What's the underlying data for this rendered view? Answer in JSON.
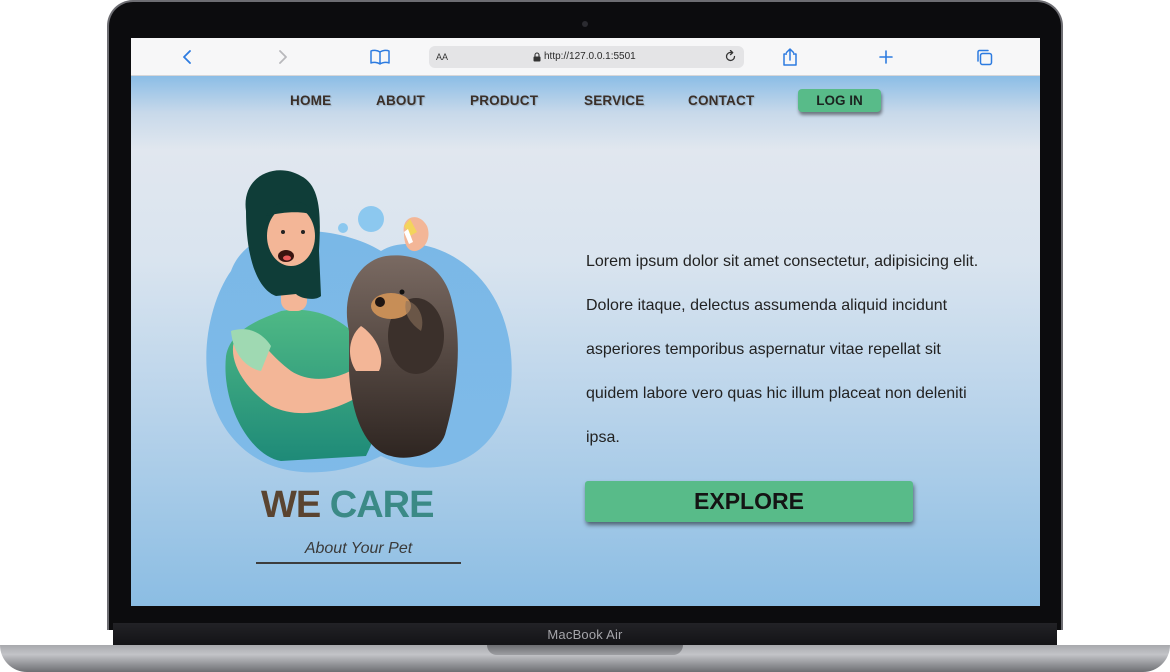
{
  "browser": {
    "reader_label": "AA",
    "url": "http://127.0.0.1:5501",
    "icons": [
      "back-icon",
      "forward-icon",
      "book-icon",
      "lock-icon",
      "reload-icon",
      "share-icon",
      "plus-icon",
      "tabs-icon"
    ]
  },
  "nav": {
    "items": [
      "HOME",
      "ABOUT",
      "PRODUCT",
      "SERVICE",
      "CONTACT"
    ],
    "login_label": "LOG IN"
  },
  "hero": {
    "title_we": "WE",
    "title_care": "CARE",
    "subtitle": "About Your Pet",
    "paragraph": "Lorem ipsum dolor sit amet consectetur, adipisicing elit. Dolore itaque, delectus assumenda aliquid incidunt asperiores temporibus aspernatur vitae repellat sit quidem labore vero quas hic illum placeat non deleniti ipsa.",
    "explore_label": "EXPLORE"
  },
  "device": {
    "label": "MacBook Air"
  },
  "colors": {
    "accent_green": "#58bb89",
    "nav_text": "#3a2f28",
    "toolbar_icon": "#2d7be0"
  }
}
